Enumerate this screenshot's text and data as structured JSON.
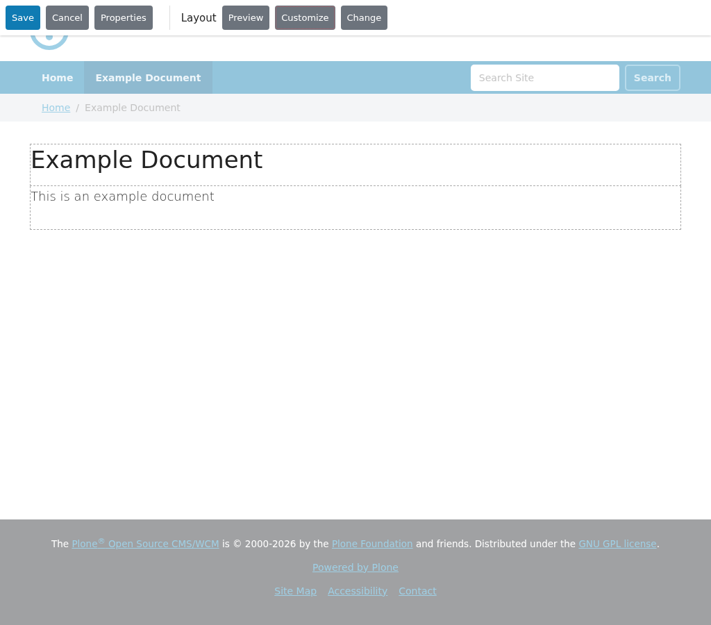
{
  "toolbar": {
    "buttons": [
      {
        "label": "Save",
        "kind": "primary",
        "focused": false
      },
      {
        "label": "Cancel",
        "kind": "secondary",
        "focused": false
      },
      {
        "label": "Properties",
        "kind": "secondary",
        "focused": false
      }
    ],
    "layout_label": "Layout",
    "layout_buttons": [
      {
        "label": "Preview",
        "kind": "secondary",
        "focused": false
      },
      {
        "label": "Customize",
        "kind": "secondary",
        "focused": true
      },
      {
        "label": "Change",
        "kind": "secondary",
        "focused": false
      }
    ]
  },
  "nav": {
    "items": [
      {
        "label": "Home",
        "selected": false
      },
      {
        "label": "Example Document",
        "selected": true
      }
    ],
    "search": {
      "placeholder": "Search Site",
      "button": "Search"
    }
  },
  "breadcrumbs": [
    {
      "label": "Home",
      "kind": "link"
    },
    {
      "label": "/",
      "kind": "separator"
    },
    {
      "label": "Example Document",
      "kind": "current"
    }
  ],
  "content": {
    "title": "Example Document",
    "body": "This is an example document"
  },
  "footer": {
    "credit": [
      {
        "text": "The",
        "kind": "text"
      },
      {
        "text": "Plone$^{®}$ Open Source CMS/WCM",
        "kind": "link"
      },
      {
        "text": "is © 2000-2026 by the",
        "kind": "text"
      },
      {
        "text": "Plone Foundation",
        "kind": "link"
      },
      {
        "text": "and friends. Distributed under the",
        "kind": "text"
      },
      {
        "text": "GNU GPL license",
        "kind": "link"
      },
      {
        "text": ".",
        "kind": "tail"
      }
    ],
    "powered": "Powered by Plone",
    "links": [
      "Site Map",
      "Accessibility",
      "Contact"
    ]
  }
}
